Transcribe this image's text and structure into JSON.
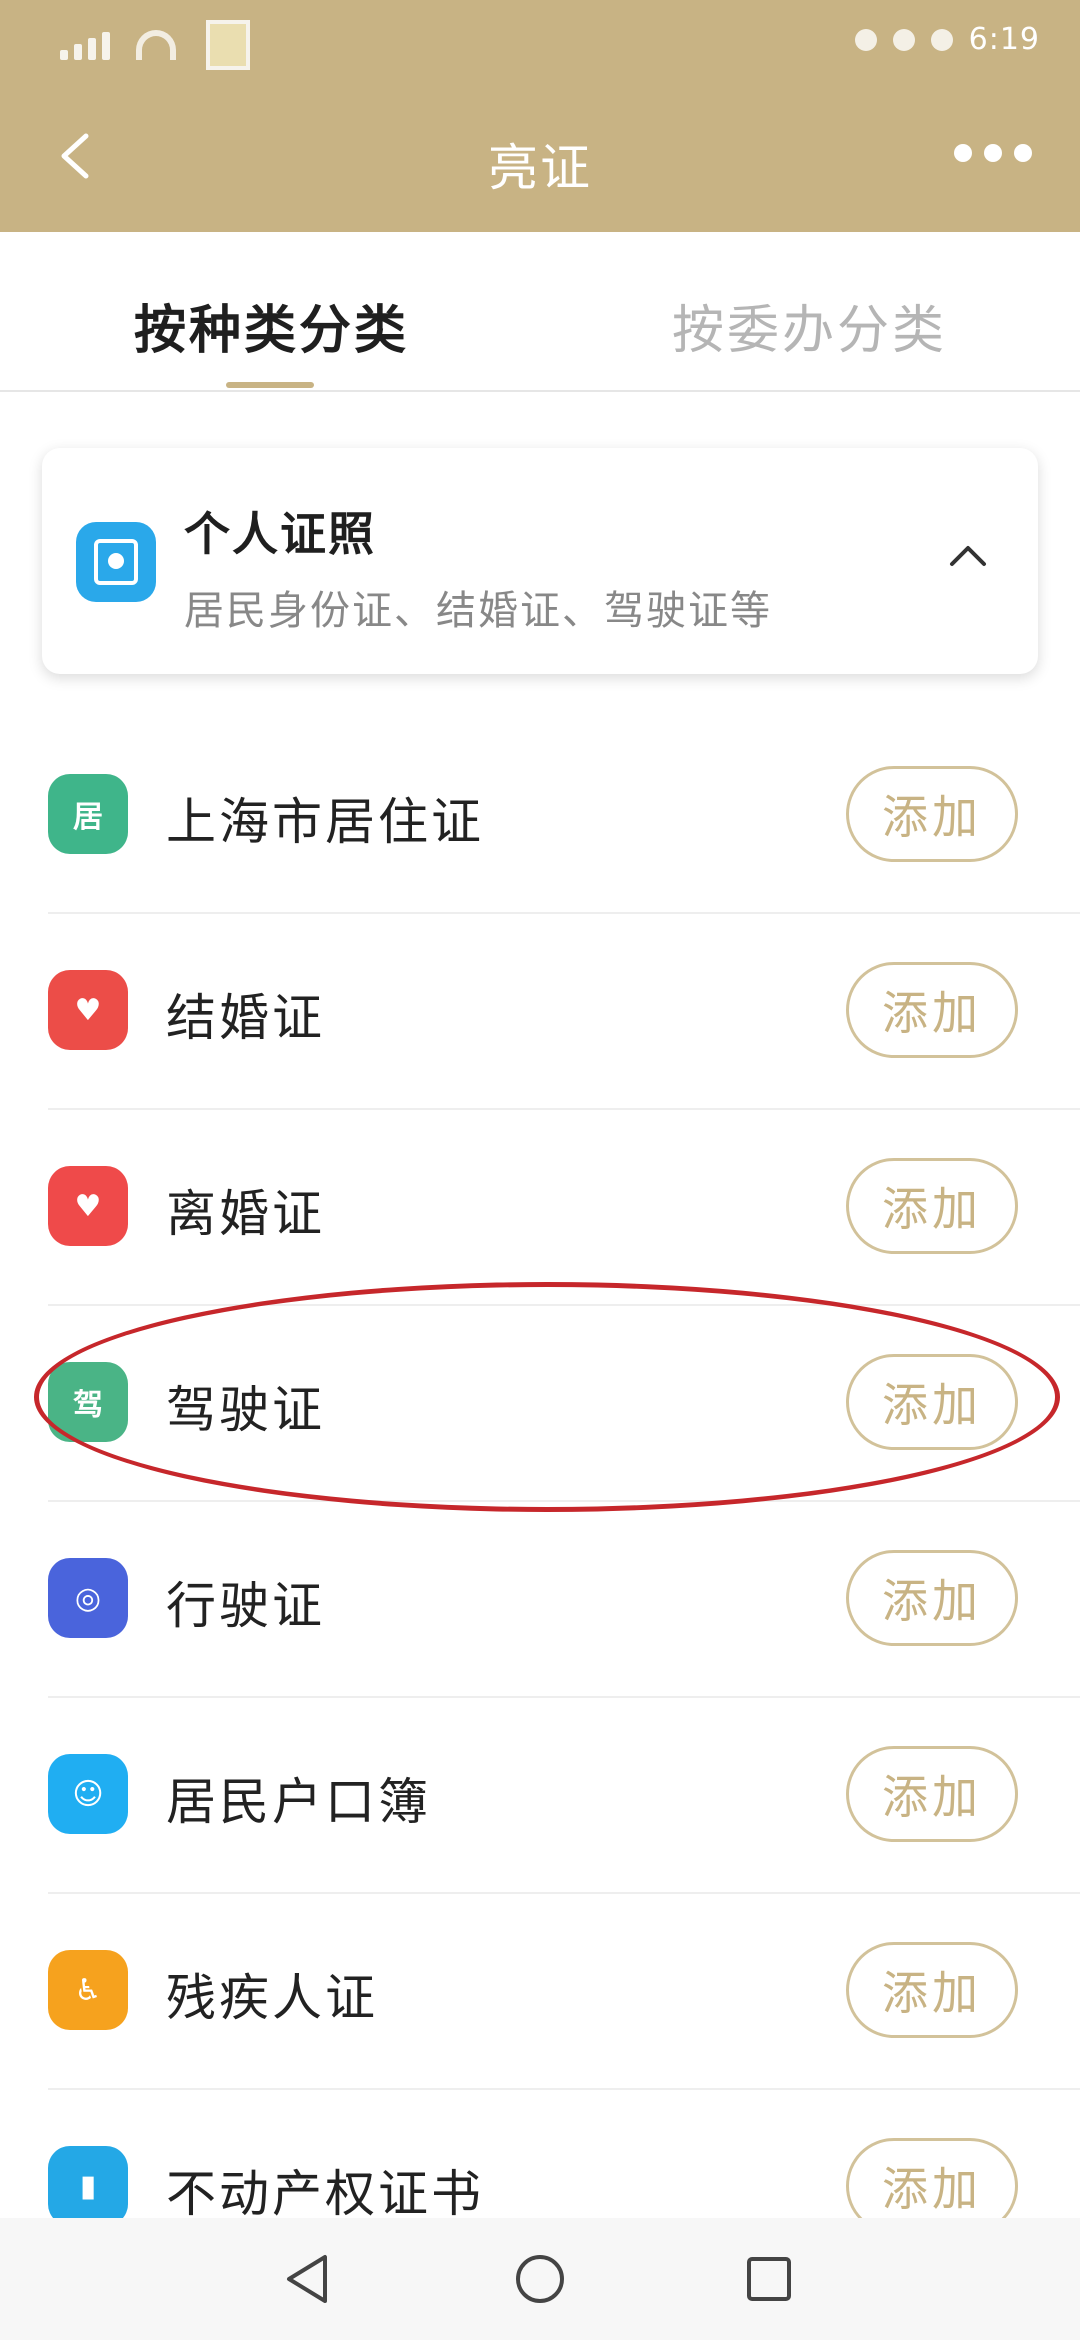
{
  "status_bar": {
    "time": "6:19"
  },
  "header": {
    "title": "亮证",
    "back_icon": "chevron-left-icon",
    "more_icon": "more-dots-icon"
  },
  "tabs": [
    {
      "label": "按种类分类",
      "active": true
    },
    {
      "label": "按委办分类",
      "active": false
    }
  ],
  "category": {
    "title": "个人证照",
    "subtitle": "居民身份证、结婚证、驾驶证等",
    "icon": "id-card-icon",
    "expanded": true
  },
  "items": [
    {
      "label": "上海市居住证",
      "icon": "residence-permit-icon",
      "glyph": "居",
      "button": "添加"
    },
    {
      "label": "结婚证",
      "icon": "marriage-certificate-icon",
      "glyph": "♥",
      "button": "添加"
    },
    {
      "label": "离婚证",
      "icon": "divorce-certificate-icon",
      "glyph": "♥",
      "button": "添加"
    },
    {
      "label": "驾驶证",
      "icon": "driver-license-icon",
      "glyph": "驾",
      "button": "添加"
    },
    {
      "label": "行驶证",
      "icon": "steering-wheel-icon",
      "glyph": "◎",
      "button": "添加"
    },
    {
      "label": "居民户口簿",
      "icon": "household-register-icon",
      "glyph": "☺",
      "button": "添加"
    },
    {
      "label": "残疾人证",
      "icon": "wheelchair-icon",
      "glyph": "♿",
      "button": "添加"
    },
    {
      "label": "不动产权证书",
      "icon": "property-certificate-icon",
      "glyph": "▮",
      "button": "添加"
    }
  ],
  "colors": {
    "header_bg": "#c8b384",
    "accent": "#c8b384",
    "highlight": "#c6272b"
  }
}
